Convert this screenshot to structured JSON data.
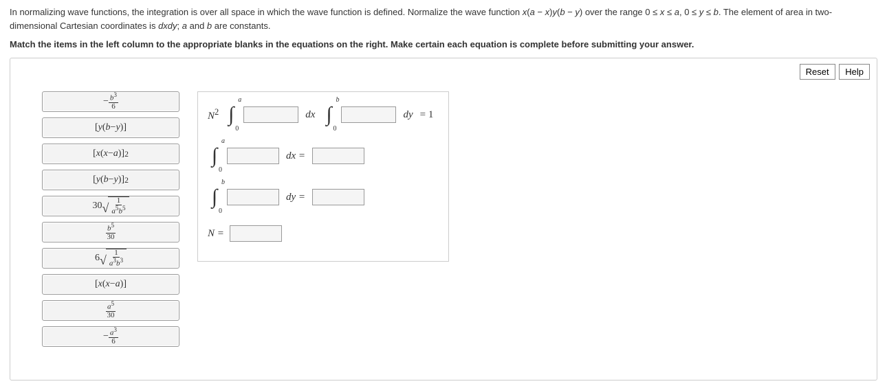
{
  "intro_html": "In normalizing wave functions, the integration is over all space in which the wave function is defined. Normalize the wave function <i>x</i>(<i>a</i> − <i>x</i>)<i>y</i>(<i>b</i> − <i>y</i>) over the range 0 ≤ <i>x</i> ≤ <i>a</i>, 0 ≤ <i>y</i> ≤ <i>b</i>. The element of area in two-dimensional Cartesian coordinates is <i>dxdy</i>; <i>a</i> and <i>b</i> are constants.",
  "match_instruction": "Match the items in the left column to the appropriate blanks in the equations on the right. Make certain each equation is complete before submitting your answer.",
  "buttons": {
    "reset": "Reset",
    "help": "Help"
  },
  "tiles": {
    "t1": "-\\frac{b^3}{6}",
    "t2": "[y(b - y)]",
    "t3": "[x(x - a)]^2",
    "t4": "[y(b - y)]^2",
    "t5": "30\\sqrt{1/(a^5 b^5)}",
    "t6": "\\frac{b^5}{30}",
    "t7": "6\\sqrt{1/(a^3 b^3)}",
    "t8": "[x(x - a)]",
    "t9": "\\frac{a^5}{30}",
    "t10": "-\\frac{a^3}{6}"
  },
  "equations": {
    "row1": {
      "prefix": "N^2",
      "int1_lower": "0",
      "int1_upper": "a",
      "mid1": "dx",
      "int2_lower": "0",
      "int2_upper": "b",
      "mid2": "dy",
      "rhs": "= 1"
    },
    "row2": {
      "int_lower": "0",
      "int_upper": "a",
      "mid": "dx =",
      "rhs": ""
    },
    "row3": {
      "int_lower": "0",
      "int_upper": "b",
      "mid": "dy =",
      "rhs": ""
    },
    "row4": {
      "lhs": "N ="
    }
  }
}
